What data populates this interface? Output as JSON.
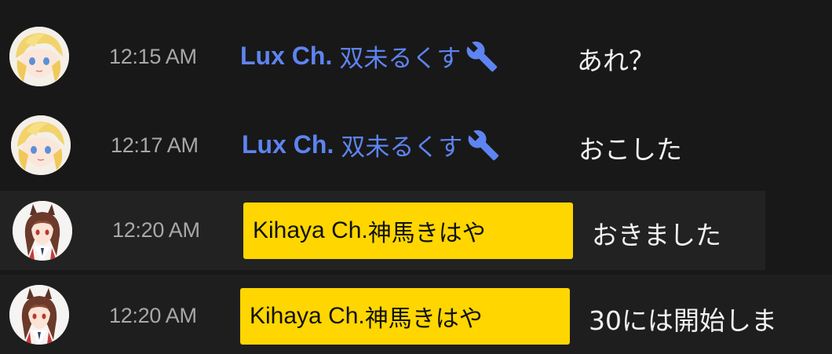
{
  "messages": [
    {
      "time": "12:15 AM",
      "author_latin": "Lux Ch.",
      "author_jp": "双未るくす",
      "role": "moderator",
      "role_icon": "wrench-icon",
      "text": "あれ？"
    },
    {
      "time": "12:17 AM",
      "author_latin": "Lux Ch.",
      "author_jp": "双未るくす",
      "role": "moderator",
      "role_icon": "wrench-icon",
      "text": "おこした"
    },
    {
      "time": "12:20 AM",
      "author_latin": "Kihaya Ch.",
      "author_jp": "神馬きはや",
      "role": "owner",
      "text": "おきました"
    },
    {
      "time": "12:20 AM",
      "author_latin": "Kihaya Ch.",
      "author_jp": "神馬きはや",
      "role": "owner",
      "text": "30には開始しま"
    }
  ],
  "colors": {
    "background": "#181818",
    "moderator_name": "#5e84f1",
    "owner_badge": "#ffd600",
    "timestamp": "#a8a8a8",
    "message_text": "#f1f1f1"
  }
}
